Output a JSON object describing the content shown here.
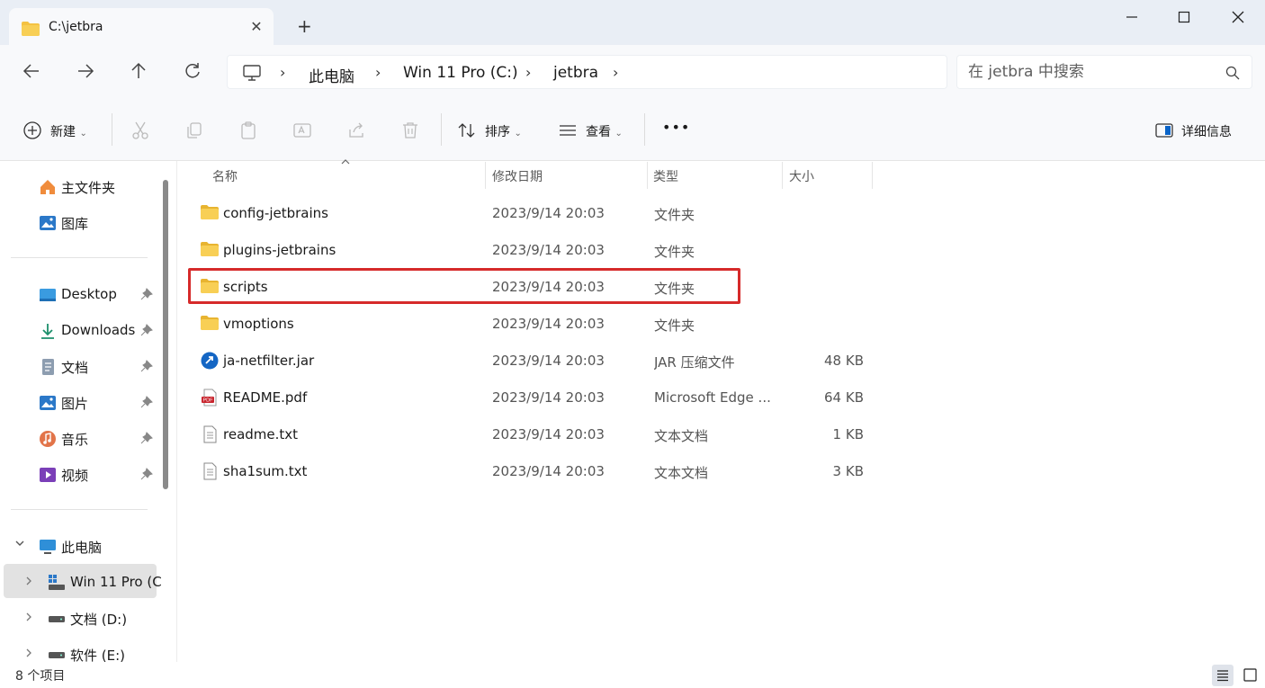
{
  "window": {
    "tab_title": "C:\\jetbra",
    "controls": {
      "minimize": "—",
      "maximize": "☐",
      "close": "✕"
    }
  },
  "breadcrumb": [
    "此电脑",
    "Win 11 Pro (C:)",
    "jetbra"
  ],
  "search": {
    "placeholder": "在 jetbra 中搜索"
  },
  "toolbar": {
    "new_label": "新建",
    "sort_label": "排序",
    "view_label": "查看",
    "more_label": "•••",
    "details_label": "详细信息"
  },
  "sidebar": {
    "quick": [
      {
        "label": "主文件夹",
        "icon": "home-icon"
      },
      {
        "label": "图库",
        "icon": "gallery-icon"
      }
    ],
    "pinned": [
      {
        "label": "Desktop",
        "icon": "desktop-icon"
      },
      {
        "label": "Downloads",
        "icon": "download-icon"
      },
      {
        "label": "文档",
        "icon": "document-icon"
      },
      {
        "label": "图片",
        "icon": "pictures-icon"
      },
      {
        "label": "音乐",
        "icon": "music-icon"
      },
      {
        "label": "视频",
        "icon": "video-icon"
      }
    ],
    "this_pc": "此电脑",
    "drives": [
      {
        "label": "Win 11 Pro (C",
        "selected": true
      },
      {
        "label": "文档 (D:)"
      },
      {
        "label": "软件 (E:)"
      }
    ]
  },
  "columns": {
    "name": "名称",
    "date": "修改日期",
    "type": "类型",
    "size": "大小"
  },
  "files": [
    {
      "name": "config-jetbrains",
      "date": "2023/9/14 20:03",
      "type": "文件夹",
      "size": "",
      "icon": "folder-icon"
    },
    {
      "name": "plugins-jetbrains",
      "date": "2023/9/14 20:03",
      "type": "文件夹",
      "size": "",
      "icon": "folder-icon"
    },
    {
      "name": "scripts",
      "date": "2023/9/14 20:03",
      "type": "文件夹",
      "size": "",
      "icon": "folder-icon",
      "highlighted": true
    },
    {
      "name": "vmoptions",
      "date": "2023/9/14 20:03",
      "type": "文件夹",
      "size": "",
      "icon": "folder-icon"
    },
    {
      "name": "ja-netfilter.jar",
      "date": "2023/9/14 20:03",
      "type": "JAR 压缩文件",
      "size": "48 KB",
      "icon": "jar-icon"
    },
    {
      "name": "README.pdf",
      "date": "2023/9/14 20:03",
      "type": "Microsoft Edge ...",
      "size": "64 KB",
      "icon": "pdf-icon"
    },
    {
      "name": "readme.txt",
      "date": "2023/9/14 20:03",
      "type": "文本文档",
      "size": "1 KB",
      "icon": "text-file-icon"
    },
    {
      "name": "sha1sum.txt",
      "date": "2023/9/14 20:03",
      "type": "文本文档",
      "size": "3 KB",
      "icon": "text-file-icon"
    }
  ],
  "status": {
    "item_count": "8 个项目"
  },
  "colors": {
    "highlight": "#d62a2a",
    "folder": "#f4c242",
    "titlebar": "#e9eef5",
    "accent": "#0a64c8"
  }
}
